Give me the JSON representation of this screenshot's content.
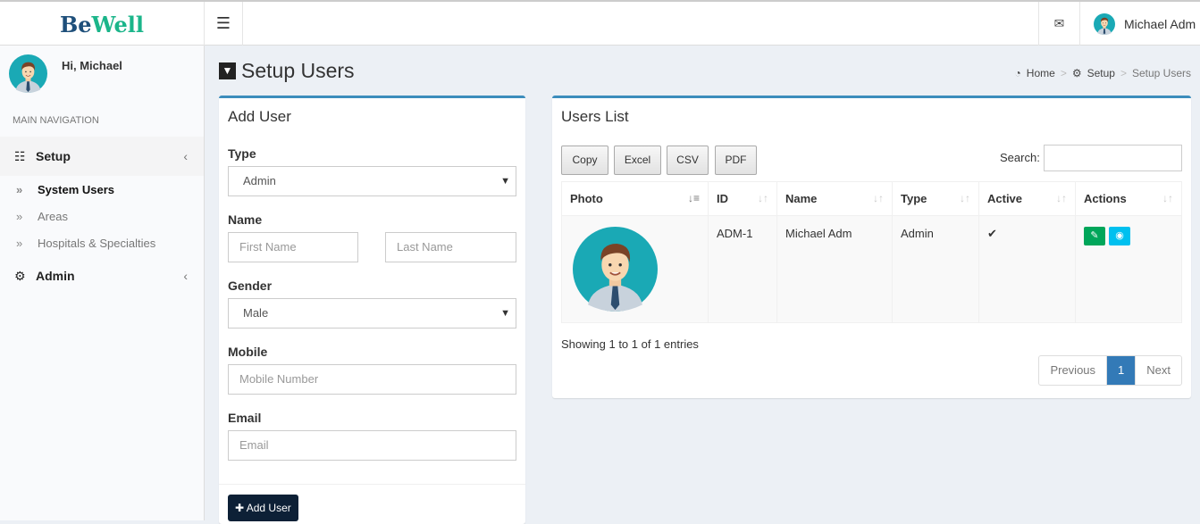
{
  "header": {
    "logo_be": "Be",
    "logo_well": "Well",
    "user_name": "Michael Adm"
  },
  "sidebar": {
    "greeting": "Hi, Michael",
    "nav_header": "MAIN NAVIGATION",
    "items": [
      {
        "label": "Setup"
      },
      {
        "label": "Admin"
      }
    ],
    "subitems": [
      {
        "label": "System Users"
      },
      {
        "label": "Areas"
      },
      {
        "label": "Hospitals & Specialties"
      }
    ]
  },
  "page": {
    "title": "Setup Users",
    "breadcrumb": [
      "Home",
      "Setup",
      "Setup Users"
    ]
  },
  "add_user": {
    "title": "Add User",
    "type_label": "Type",
    "type_value": "Admin",
    "name_label": "Name",
    "first_placeholder": "First Name",
    "last_placeholder": "Last Name",
    "gender_label": "Gender",
    "gender_value": "Male",
    "mobile_label": "Mobile",
    "mobile_placeholder": "Mobile Number",
    "email_label": "Email",
    "email_placeholder": "Email",
    "submit": "Add User"
  },
  "users_list": {
    "title": "Users List",
    "buttons": [
      "Copy",
      "Excel",
      "CSV",
      "PDF"
    ],
    "search_label": "Search:",
    "columns": [
      "Photo",
      "ID",
      "Name",
      "Type",
      "Active",
      "Actions"
    ],
    "rows": [
      {
        "id": "ADM-1",
        "name": "Michael Adm",
        "type": "Admin",
        "active": "✔"
      }
    ],
    "info": "Showing 1 to 1 of 1 entries",
    "pagination": {
      "prev": "Previous",
      "current": "1",
      "next": "Next"
    }
  },
  "colors": {
    "accent": "#3c8dbc",
    "edit": "#00a65a",
    "view": "#00c0ef",
    "logo_dark": "#1e4f7a",
    "logo_green": "#1bb58a"
  }
}
